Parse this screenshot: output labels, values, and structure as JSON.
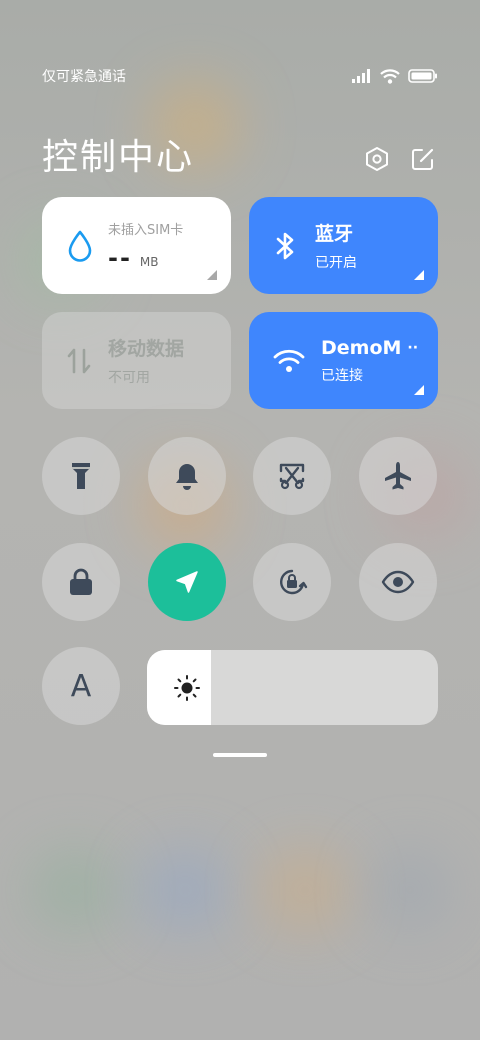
{
  "status_bar": {
    "carrier_text": "仅可紧急通话",
    "icons": [
      "signal-icon",
      "wifi-icon",
      "battery-icon"
    ]
  },
  "header": {
    "title": "控制中心",
    "settings_icon": "settings-hexagon-icon",
    "edit_icon": "edit-icon"
  },
  "tiles": {
    "data_usage": {
      "label": "未插入SIM卡",
      "value": "--",
      "unit": "MB",
      "icon": "water-drop-icon"
    },
    "bluetooth": {
      "title": "蓝牙",
      "status": "已开启",
      "icon": "bluetooth-icon"
    },
    "mobile_data": {
      "title": "移动数据",
      "status": "不可用",
      "icon": "mobile-data-arrows-icon"
    },
    "wifi": {
      "title": "DemoM",
      "title_suffix": "··",
      "status": "已连接",
      "icon": "wifi-icon"
    }
  },
  "toggles": [
    {
      "name": "flashlight",
      "icon": "flashlight-icon",
      "active": false
    },
    {
      "name": "bell",
      "icon": "bell-icon",
      "active": false
    },
    {
      "name": "screenshot",
      "icon": "scissors-screenshot-icon",
      "active": false
    },
    {
      "name": "airplane",
      "icon": "airplane-icon",
      "active": false
    },
    {
      "name": "lock",
      "icon": "lock-icon",
      "active": false
    },
    {
      "name": "location",
      "icon": "location-arrow-icon",
      "active": true
    },
    {
      "name": "rotation-lock",
      "icon": "rotation-lock-icon",
      "active": false
    },
    {
      "name": "eye-comfort",
      "icon": "eye-icon",
      "active": false
    },
    {
      "name": "font-size",
      "icon": "font-a-icon",
      "label": "A",
      "active": false
    }
  ],
  "brightness": {
    "level_fraction": 0.22,
    "icon": "sun-icon"
  },
  "colors": {
    "accent_blue": "#3f86fd",
    "active_green": "#1cbf9a",
    "icon_dark": "#3e4a5a"
  }
}
